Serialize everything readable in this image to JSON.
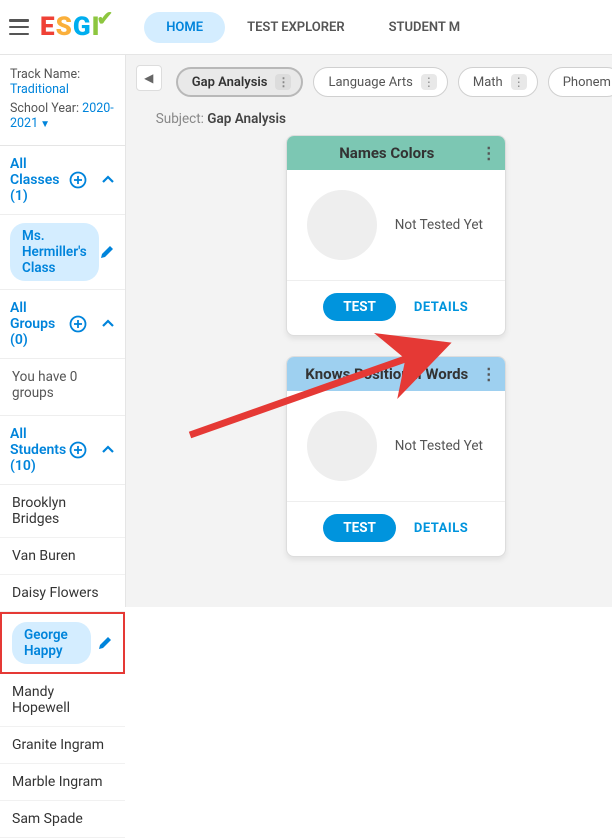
{
  "nav": {
    "home": "HOME",
    "testExplorer": "TEST EXPLORER",
    "studentM": "STUDENT M"
  },
  "meta": {
    "trackLabel": "Track Name:",
    "trackValue": "Traditional",
    "yearLabel": "School Year:",
    "yearValue": "2020-2021"
  },
  "sections": {
    "classesTitle": "All Classes (1)",
    "className": "Ms. Hermiller's Class",
    "groupsTitle": "All Groups (0)",
    "noGroupsText": "You have 0 groups",
    "studentsTitle": "All Students (10)"
  },
  "students": {
    "s0": "Brooklyn Bridges",
    "s1": "Van Buren",
    "s2": "Daisy Flowers",
    "s3": "George Happy",
    "s4": "Mandy Hopewell",
    "s5": "Granite Ingram",
    "s6": "Marble Ingram",
    "s7": "Sam Spade"
  },
  "chips": {
    "gap": "Gap Analysis",
    "lang": "Language Arts",
    "math": "Math",
    "phon": "Phonem"
  },
  "subject": {
    "label": "Subject:",
    "value": "Gap Analysis"
  },
  "cards": {
    "c1": {
      "title": "Names Colors",
      "status": "Not Tested Yet",
      "test": "TEST",
      "details": "DETAILS"
    },
    "c2": {
      "title": "Knows Positional Words",
      "status": "Not Tested Yet",
      "test": "TEST",
      "details": "DETAILS"
    }
  }
}
